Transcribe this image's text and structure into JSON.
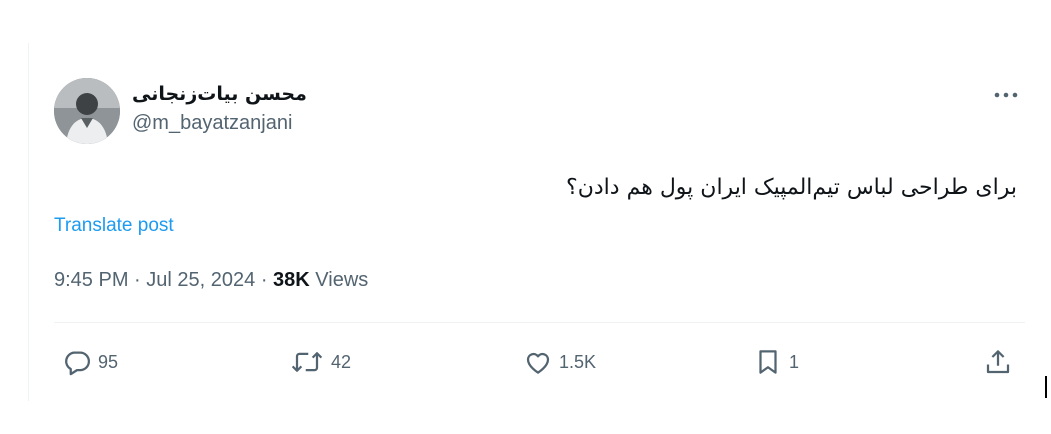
{
  "author": {
    "display_name": "محسن بیات‌زنجانی",
    "handle": "@m_bayatzanjani"
  },
  "tweet": {
    "text": "برای طراحی لباس تیم‌المپیک ایران پول هم دادن؟",
    "translate_label": "Translate post",
    "time": "9:45 PM",
    "date": "Jul 25, 2024",
    "views_count": "38K",
    "views_label": "Views"
  },
  "actions": {
    "replies": "95",
    "reposts": "42",
    "likes": "1.5K",
    "bookmarks": "1"
  },
  "colors": {
    "accent": "#1d9bf0",
    "secondary_text": "#536471",
    "primary_text": "#0f1419",
    "divider": "#eff3f4"
  },
  "icons": [
    "more-icon",
    "reply-icon",
    "repost-icon",
    "like-icon",
    "bookmark-icon",
    "share-icon"
  ]
}
